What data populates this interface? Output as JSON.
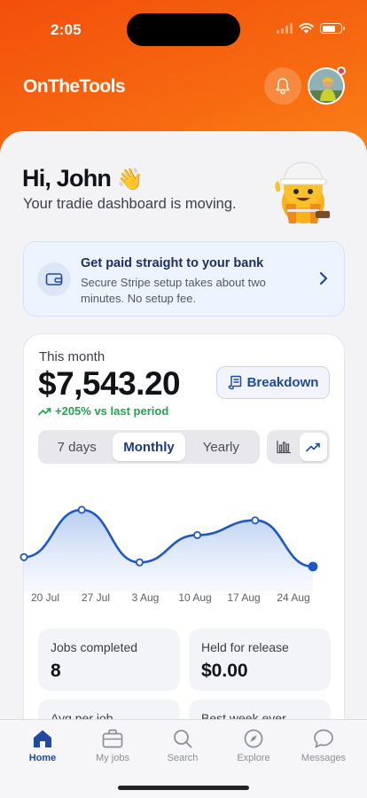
{
  "status_bar": {
    "time": "2:05"
  },
  "header": {
    "brand": "OnTheTools"
  },
  "greeting": {
    "title": "Hi, John",
    "emoji": "👋",
    "subtitle": "Your tradie dashboard is moving."
  },
  "stripe_banner": {
    "title": "Get paid straight to your bank",
    "text": "Secure Stripe setup takes about two minutes. No setup fee."
  },
  "earnings": {
    "period_label": "This month",
    "amount": "$7,543.20",
    "change": "+205% vs last period",
    "breakdown_label": "Breakdown",
    "periods": [
      "7 days",
      "Monthly",
      "Yearly"
    ],
    "active_period": "Monthly"
  },
  "chart_data": {
    "type": "line",
    "x": [
      "20 Jul",
      "27 Jul",
      "3 Aug",
      "10 Aug",
      "17 Aug",
      "24 Aug"
    ],
    "values": [
      0.1,
      1.0,
      0.0,
      0.52,
      0.8,
      -0.08
    ],
    "line_color": "#1f57c3",
    "fill": true,
    "grid": false
  },
  "stats": [
    {
      "label": "Jobs completed",
      "value": "8"
    },
    {
      "label": "Held for release",
      "value": "$0.00"
    },
    {
      "label": "Avg per job",
      "value": ""
    },
    {
      "label": "Best week ever",
      "value": ""
    }
  ],
  "tabs": [
    {
      "label": "Home",
      "icon": "home-icon",
      "active": true
    },
    {
      "label": "My jobs",
      "icon": "briefcase-icon",
      "active": false
    },
    {
      "label": "Search",
      "icon": "search-icon",
      "active": false
    },
    {
      "label": "Explore",
      "icon": "compass-icon",
      "active": false
    },
    {
      "label": "Messages",
      "icon": "chat-bubble-icon",
      "active": false
    }
  ],
  "colors": {
    "brand_orange": "#f24f0b",
    "accent_blue": "#1f4aa0",
    "positive_green": "#23a24d",
    "notification_red": "#ef3b3b"
  }
}
